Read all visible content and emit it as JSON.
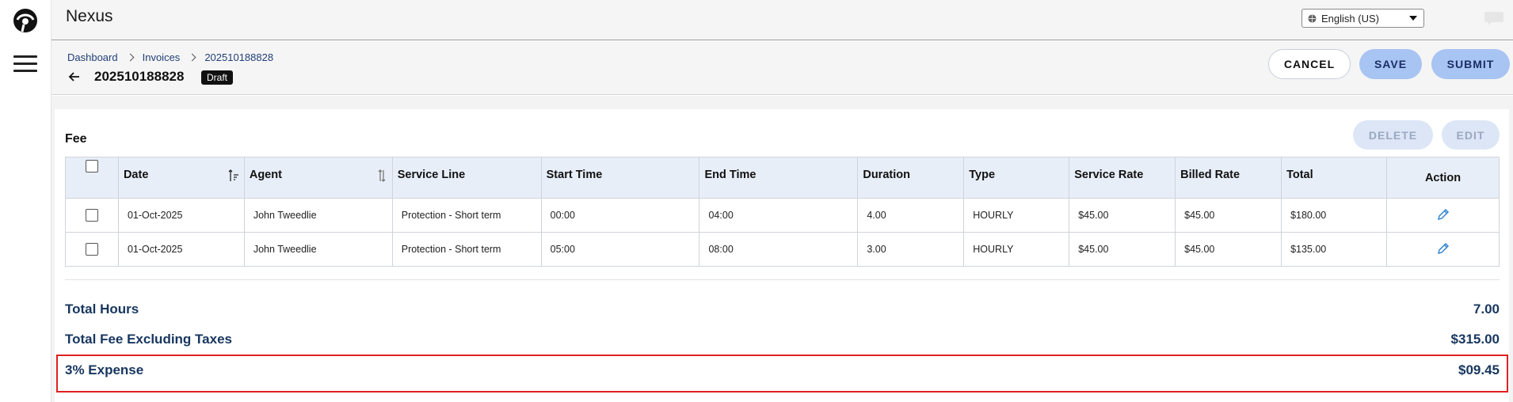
{
  "app": {
    "title": "Nexus"
  },
  "header": {
    "language": "English (US)",
    "icons": {
      "chat": "chat-bubble-icon",
      "user": "user-avatar-icon",
      "globe": "globe-icon"
    }
  },
  "breadcrumb": [
    "Dashboard",
    "Invoices",
    "202510188828"
  ],
  "page": {
    "invoice_id": "202510188828",
    "status_badge": "Draft",
    "buttons": {
      "cancel": "CANCEL",
      "save": "SAVE",
      "submit": "SUBMIT"
    }
  },
  "fee": {
    "title": "Fee",
    "buttons": {
      "delete": "DELETE",
      "edit": "EDIT"
    },
    "columns": [
      "Date",
      "Agent",
      "Service Line",
      "Start Time",
      "End Time",
      "Duration",
      "Type",
      "Service Rate",
      "Billed Rate",
      "Total",
      "Action"
    ],
    "rows": [
      {
        "date": "01-Oct-2025",
        "agent": "John Tweedlie",
        "service_line": "Protection - Short term",
        "start_time": "00:00",
        "end_time": "04:00",
        "duration": "4.00",
        "type": "HOURLY",
        "service_rate": "$45.00",
        "billed_rate": "$45.00",
        "total": "$180.00"
      },
      {
        "date": "01-Oct-2025",
        "agent": "John Tweedlie",
        "service_line": "Protection - Short term",
        "start_time": "05:00",
        "end_time": "08:00",
        "duration": "3.00",
        "type": "HOURLY",
        "service_rate": "$45.00",
        "billed_rate": "$45.00",
        "total": "$135.00"
      }
    ]
  },
  "totals": {
    "hours_label": "Total Hours",
    "hours_value": "7.00",
    "fee_label": "Total Fee Excluding Taxes",
    "fee_value": "$315.00",
    "expense_label": "3% Expense",
    "expense_value": "$09.45"
  },
  "colors": {
    "primary_button": "#a8c4f2",
    "highlight_border": "#e02020",
    "totals_text": "#17365f",
    "table_header": "#e8eef8"
  }
}
